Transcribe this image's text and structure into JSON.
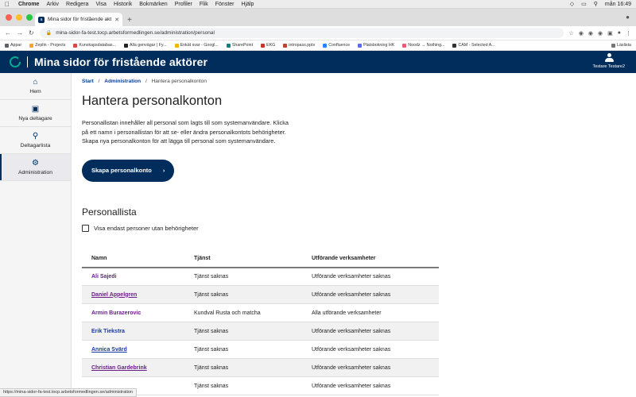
{
  "mac": {
    "app": "Chrome",
    "menus": [
      "Arkiv",
      "Redigera",
      "Visa",
      "Historik",
      "Bokmärken",
      "Profiler",
      "Flik",
      "Fönster",
      "Hjälp"
    ],
    "clock": "mån 16:49"
  },
  "browser": {
    "tab_title": "Mina sidor för fristående aktörer",
    "url": "mina-sidor-fa-test.tocp.arbetsformedlingen.se/administration/personal",
    "bookmarks": [
      {
        "label": "Appar",
        "color": "#5f6368"
      },
      {
        "label": "Zeplin - Projects",
        "color": "#f5a623"
      },
      {
        "label": "Kunskapsdatabas...",
        "color": "#d94c3d"
      },
      {
        "label": "Alla genvägar | Fy...",
        "color": "#222222"
      },
      {
        "label": "Enkät svar - Googl...",
        "color": "#f4b400"
      },
      {
        "label": "SharePoint",
        "color": "#038387"
      },
      {
        "label": "EKG",
        "color": "#c0392b"
      },
      {
        "label": "intropass.pptx",
        "color": "#b7472a"
      },
      {
        "label": "Confluence",
        "color": "#2684ff"
      },
      {
        "label": "Platsbokning HK",
        "color": "#5b6ee1"
      },
      {
        "label": "Noodz → Nothing...",
        "color": "#e85d75"
      },
      {
        "label": "CAM - Selected A...",
        "color": "#333333"
      }
    ],
    "reading_list": "Läslista",
    "status_url": "https://mina-sidor-fa-test.tocp.arbetsformedlingen.se/administration"
  },
  "header": {
    "title": "Mina sidor för fristående aktörer",
    "user_name": "Testare Testare2"
  },
  "sidebar": {
    "items": [
      {
        "label": "Hem",
        "icon": "home-icon"
      },
      {
        "label": "Nya deltagare",
        "icon": "clipboard-icon"
      },
      {
        "label": "Deltagarlista",
        "icon": "search-user-icon"
      },
      {
        "label": "Administration",
        "icon": "gear-icon"
      }
    ]
  },
  "breadcrumb": {
    "start": "Start",
    "admin": "Administration",
    "current": "Hantera personalkonton"
  },
  "page": {
    "title": "Hantera personalkonton",
    "intro": "Personallistan innehåller all personal som lagts till som systemanvändare. Klicka på ett namn i personallistan för att se- eller ändra personalkontots behörigheter. Skapa nya personalkonton för att lägga till personal som systemanvändare.",
    "create_button": "Skapa personalkonto",
    "list_heading": "Personallista",
    "filter_label": "Visa endast personer utan behörigheter"
  },
  "table": {
    "headers": [
      "Namn",
      "Tjänst",
      "Utförande verksamheter"
    ],
    "rows": [
      {
        "name": "Ali Sajedi",
        "service": "Tjänst saknas",
        "units": "Utförande verksamheter saknas"
      },
      {
        "name": "Daniel Appelgren",
        "service": "Tjänst saknas",
        "units": "Utförande verksamheter saknas"
      },
      {
        "name": "Armin Burazerovic",
        "service": "Kundval Rusta och matcha",
        "units": "Alla utförande verksamheter"
      },
      {
        "name": "Erik Tiekstra",
        "service": "Tjänst saknas",
        "units": "Utförande verksamheter saknas"
      },
      {
        "name": "Annica Svärd",
        "service": "Tjänst saknas",
        "units": "Utförande verksamheter saknas"
      },
      {
        "name": "Christian Gardebrink",
        "service": "Tjänst saknas",
        "units": "Utförande verksamheter saknas"
      },
      {
        "name": "",
        "service": "Tjänst saknas",
        "units": "Utförande verksamheter saknas"
      }
    ]
  }
}
